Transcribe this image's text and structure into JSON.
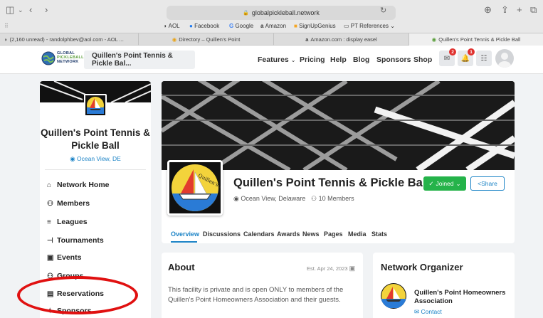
{
  "browser": {
    "url": "globalpickleball.network",
    "bookmarks": [
      "AOL",
      "Facebook",
      "Google",
      "Amazon",
      "SignUpGenius",
      "PT References"
    ],
    "tabs": [
      {
        "label": "(2,160 unread) - randolphbev@aol.com - AOL ..."
      },
      {
        "label": "Directory – Quillen's Point"
      },
      {
        "label": "Amazon.com : display easel"
      },
      {
        "label": "Quillen's Point Tennis & Pickle Ball"
      }
    ]
  },
  "header": {
    "logo_text": [
      "GLOBAL",
      "PICKLEBALL",
      "NETWORK"
    ],
    "network_select": "Quillen's Point Tennis & Pickle Bal...",
    "nav": [
      "Features",
      "Pricing",
      "Help",
      "Blog",
      "Sponsors",
      "Shop"
    ],
    "messages_badge": "2",
    "notifications_badge": "1"
  },
  "sidebar": {
    "title": "Quillen's Point Tennis & Pickle Ball",
    "location": "Ocean View, DE",
    "items": [
      {
        "label": "Network Home",
        "icon": "home-icon"
      },
      {
        "label": "Members",
        "icon": "members-icon"
      },
      {
        "label": "Leagues",
        "icon": "list-icon"
      },
      {
        "label": "Tournaments",
        "icon": "bracket-icon"
      },
      {
        "label": "Events",
        "icon": "calendar-icon"
      },
      {
        "label": "Groups",
        "icon": "groups-icon"
      },
      {
        "label": "Reservations",
        "icon": "reservations-icon"
      },
      {
        "label": "Sponsors",
        "icon": "sponsors-icon"
      }
    ]
  },
  "profile": {
    "title": "Quillen's Point Tennis & Pickle Ball",
    "logo_text": "Quillen's Point",
    "location": "Ocean View, Delaware",
    "members": "10 Members",
    "joined_label": "Joined",
    "share_label": "Share",
    "tabs": [
      "Overview",
      "Discussions",
      "Calendars",
      "Awards",
      "News",
      "Pages",
      "Media",
      "Stats"
    ]
  },
  "about": {
    "title": "About",
    "established": "Est. Apr 24, 2023",
    "text": "This facility is private and is open ONLY to members of the Quillen's Point Homeowners Association and their guests."
  },
  "organizer": {
    "title": "Network Organizer",
    "name": "Quillen's Point Homeowners Association",
    "contact_label": "Contact"
  },
  "colors": {
    "accent": "#1b83c6",
    "joined": "#25b34a",
    "badge": "#e0312e",
    "annotation": "#e01010"
  }
}
